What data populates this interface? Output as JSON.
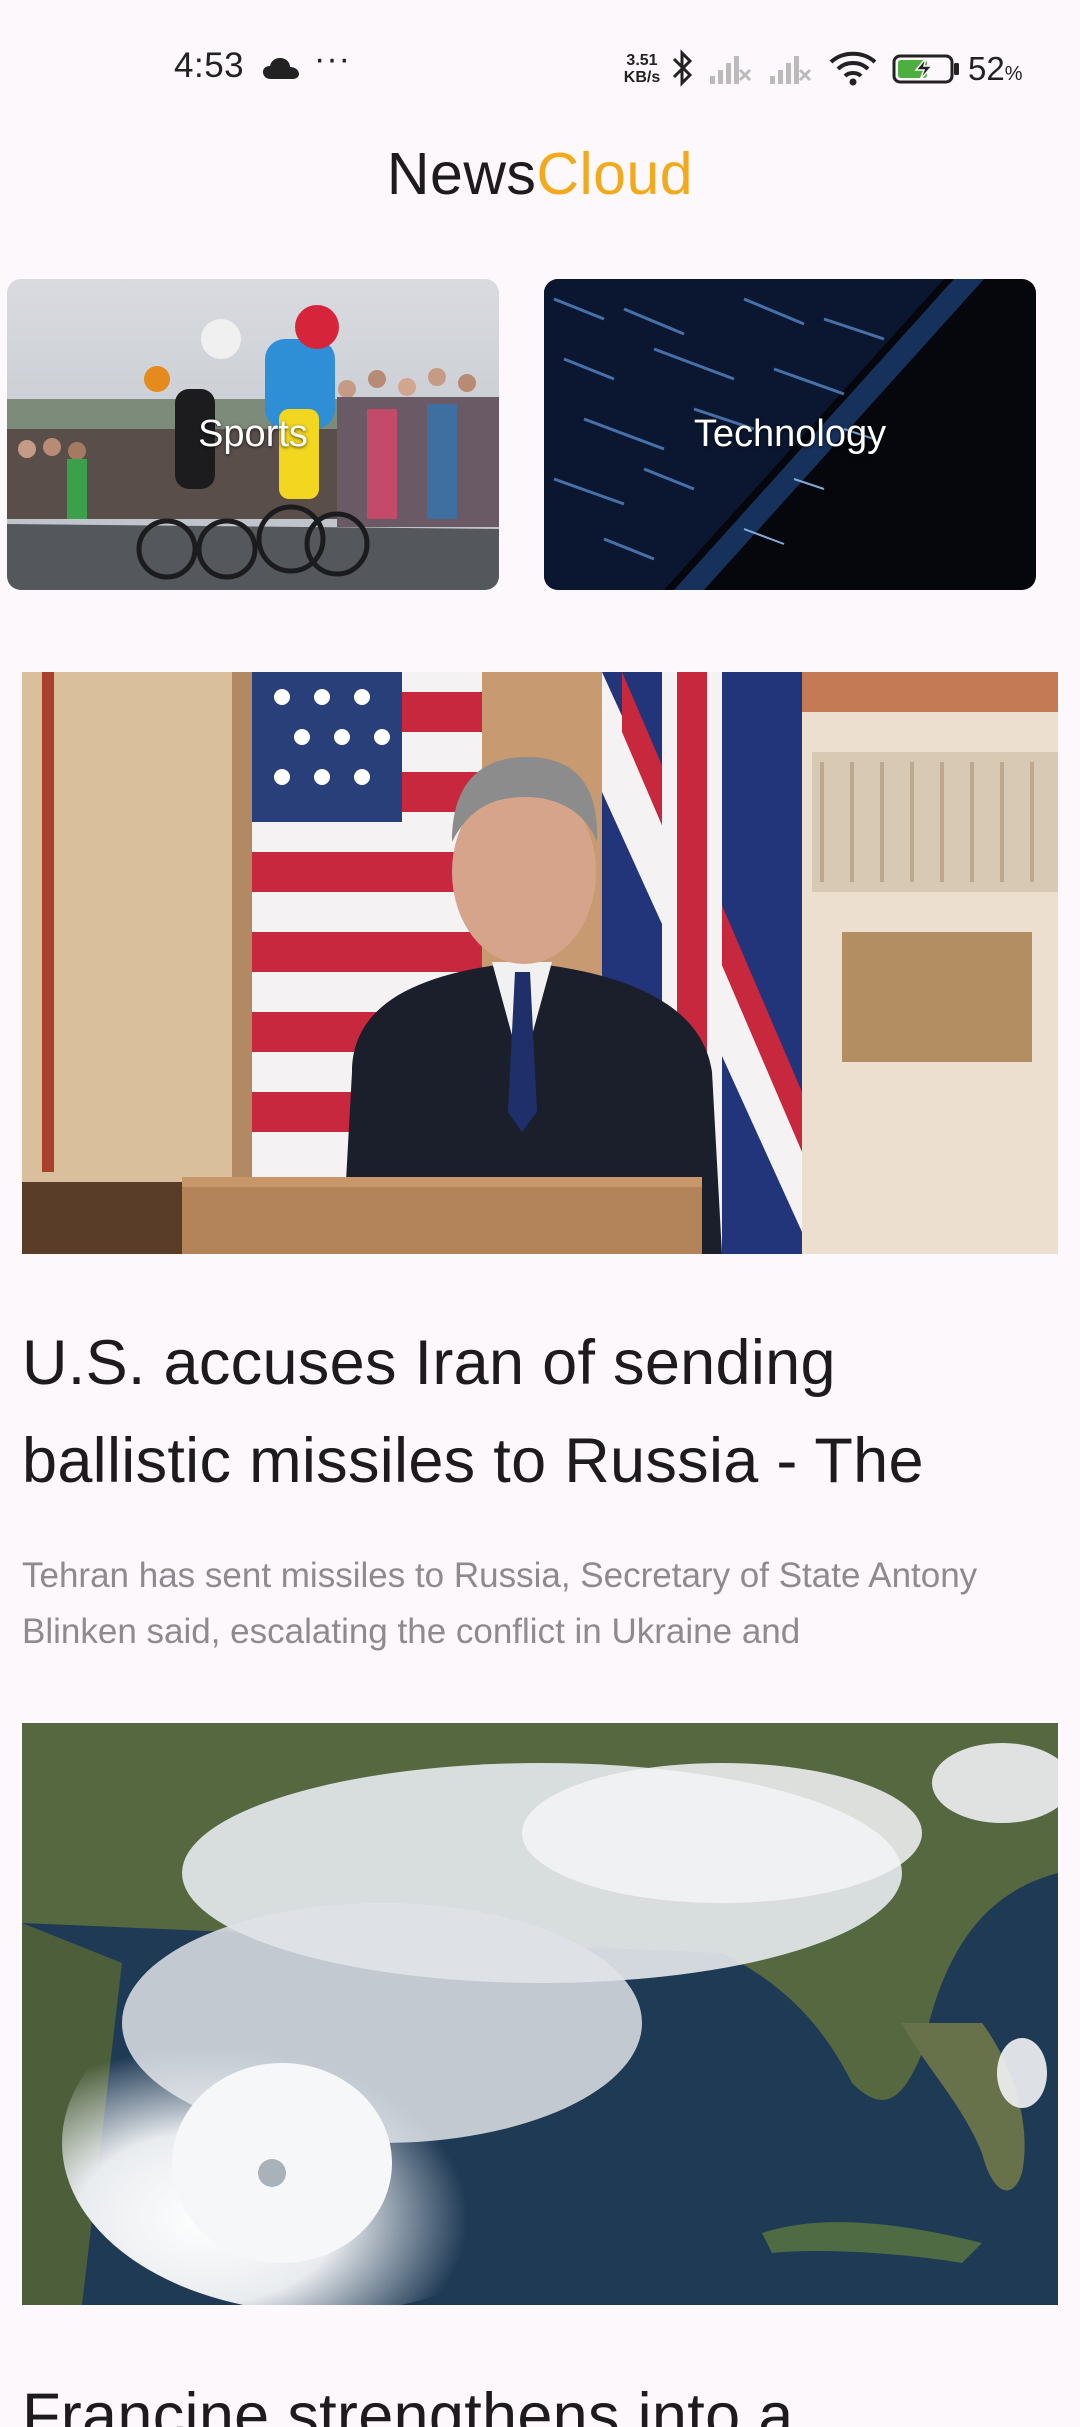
{
  "status_bar": {
    "time": "4:53",
    "more": "···",
    "net_speed_value": "3.51",
    "net_speed_unit": "KB/s",
    "battery_percent": "52",
    "battery_unit": "%"
  },
  "app": {
    "title_part1": "News",
    "title_part2": "Cloud",
    "accent_color": "#f2a91c"
  },
  "categories": [
    {
      "label": "Sports",
      "image": "cyclists-race-photo"
    },
    {
      "label": "Technology",
      "image": "digital-data-streams-photo"
    }
  ],
  "articles": [
    {
      "headline": "U.S. accuses Iran of sending ballistic missiles to Russia - The",
      "summary": "Tehran has sent missiles to Russia, Secretary of State Antony Blinken said, escalating the conflict in Ukraine and",
      "image": "press-conference-flags-photo"
    },
    {
      "headline": "Francine strengthens into a",
      "summary": "",
      "image": "hurricane-satellite-photo"
    }
  ]
}
